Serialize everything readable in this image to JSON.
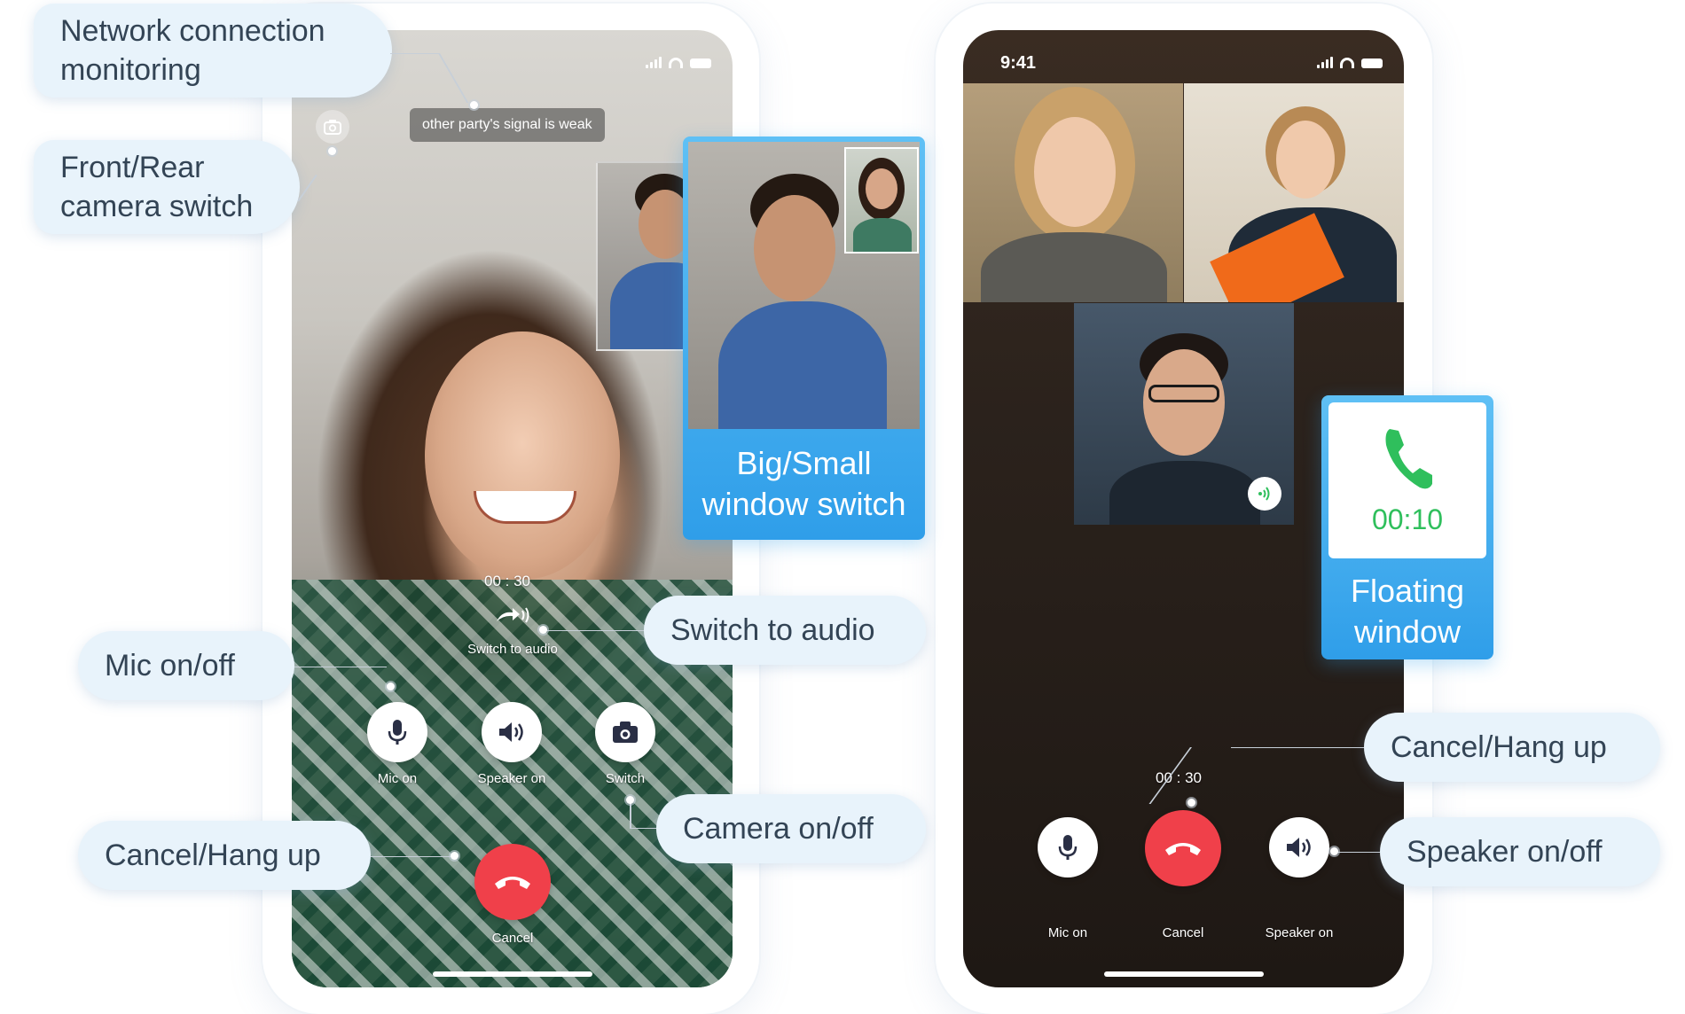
{
  "left_phone": {
    "toast": "other party's signal is weak",
    "timer": "00 : 30",
    "switch_to_audio_label": "Switch to audio",
    "controls": {
      "mic_label": "Mic on",
      "speaker_label": "Speaker on",
      "switch_label": "Switch",
      "cancel_label": "Cancel"
    }
  },
  "right_phone": {
    "status_time": "9:41",
    "timer": "00 : 30",
    "controls": {
      "mic_label": "Mic on",
      "cancel_label": "Cancel",
      "speaker_label": "Speaker on"
    },
    "floating_window_time": "00:10"
  },
  "callouts": {
    "network": "Network connection monitoring",
    "camera_switch": "Front/Rear camera switch",
    "big_small": "Big/Small window switch",
    "switch_audio": "Switch to audio",
    "mic": "Mic on/off",
    "camera_onoff": "Camera on/off",
    "cancel_left": "Cancel/Hang up",
    "floating": "Floating window",
    "cancel_right": "Cancel/Hang up",
    "speaker": "Speaker on/off"
  },
  "colors": {
    "callout_bg": "#e8f3fb",
    "callout_text": "#334455",
    "accent_blue": "#2f9ee9",
    "hangup_red": "#f0404a",
    "call_green": "#2fbf5c"
  },
  "icons": [
    "camera-switch-icon",
    "mic-icon",
    "speaker-icon",
    "camera-icon",
    "hangup-icon",
    "phone-icon",
    "audio-arrow-icon",
    "sound-wave-icon"
  ]
}
